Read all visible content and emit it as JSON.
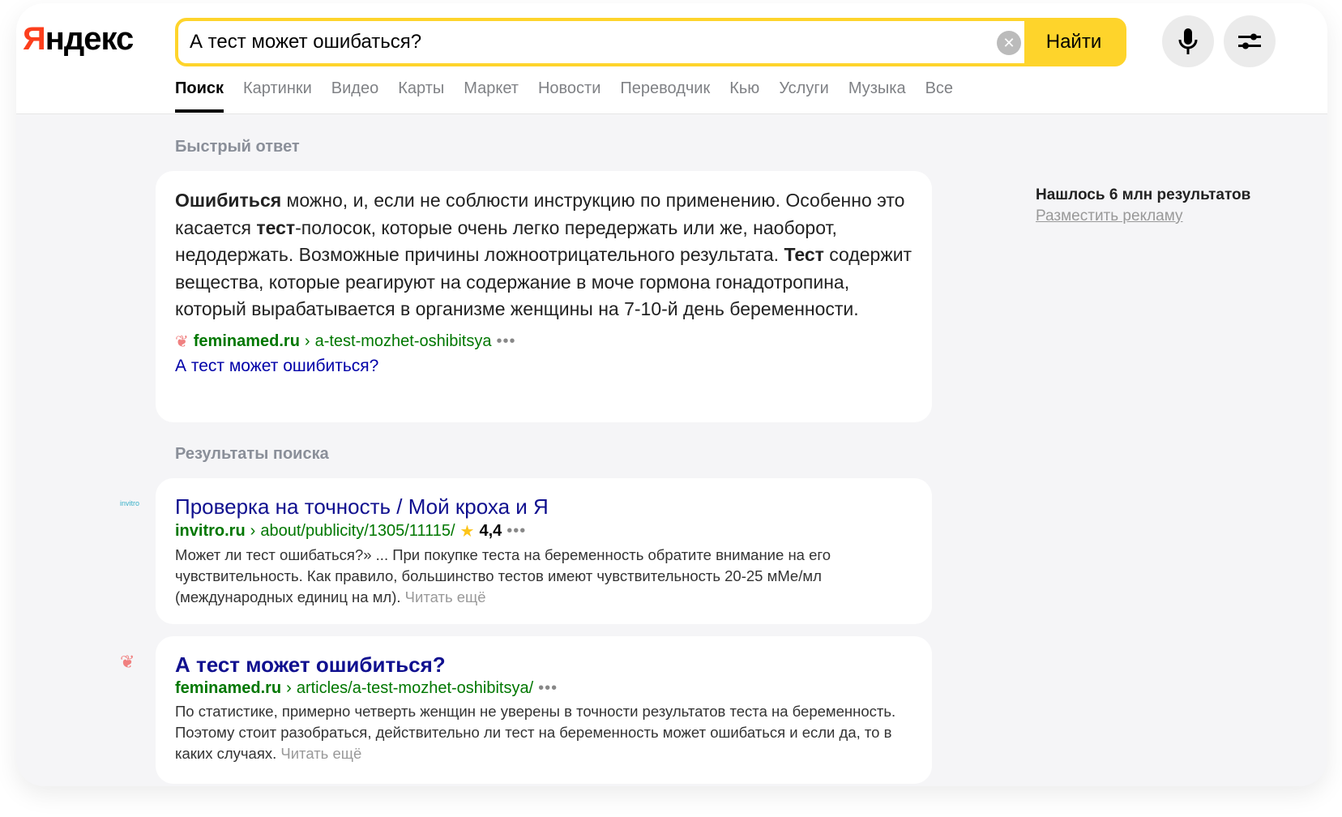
{
  "logo": "Яндекс",
  "search": {
    "value": "А тест может ошибаться?",
    "button": "Найти"
  },
  "tabs": [
    "Поиск",
    "Картинки",
    "Видео",
    "Карты",
    "Маркет",
    "Новости",
    "Переводчик",
    "Кью",
    "Услуги",
    "Музыка",
    "Все"
  ],
  "quick_answer": {
    "heading": "Быстрый ответ",
    "parts": [
      "Ошибиться",
      " можно, и, если не соблюсти инструкцию по применению. Особенно это касается ",
      "тест",
      "-полосок, которые очень легко передержать или же, наоборот, недодержать. Возможные причины ложноотрицательного результата. ",
      "Тест",
      " содержит вещества, которые реагируют на содержание в моче гормона гонадотропина, который вырабатывается в организме женщины на 7-10-й день беременности."
    ],
    "domain": "feminamed.ru",
    "path": "a-test-mozhet-oshibitsya",
    "link": "А тест может ошибиться?"
  },
  "results_heading": "Результаты поиска",
  "results": [
    {
      "title": "Проверка на точность / Мой кроха и Я",
      "domain": "invitro.ru",
      "path": "about/publicity/1305/11115/",
      "rating": "4,4",
      "snippet": "Может ли тест ошибаться?» ... При покупке теста на беременность обратите внимание на его чувствительность. Как правило, большинство тестов имеют чувствительность 20-25 мМе/мл (международных единиц на мл).",
      "more": "Читать ещё"
    },
    {
      "title": "А тест может ошибиться?",
      "domain": "feminamed.ru",
      "path": "articles/a-test-mozhet-oshibitsya/",
      "snippet": "По статистике, примерно четверть женщин не уверены в точности результатов теста на беременность. Поэтому стоит разобраться, действительно ли тест на беременность может ошибаться и если да, то в каких случаях.",
      "more": "Читать ещё"
    }
  ],
  "sidebar": {
    "count": "Нашлось 6 млн результатов",
    "ad": "Разместить рекламу"
  },
  "colors": {
    "accent": "#fed42b",
    "link": "#10108f",
    "url": "#007700"
  }
}
